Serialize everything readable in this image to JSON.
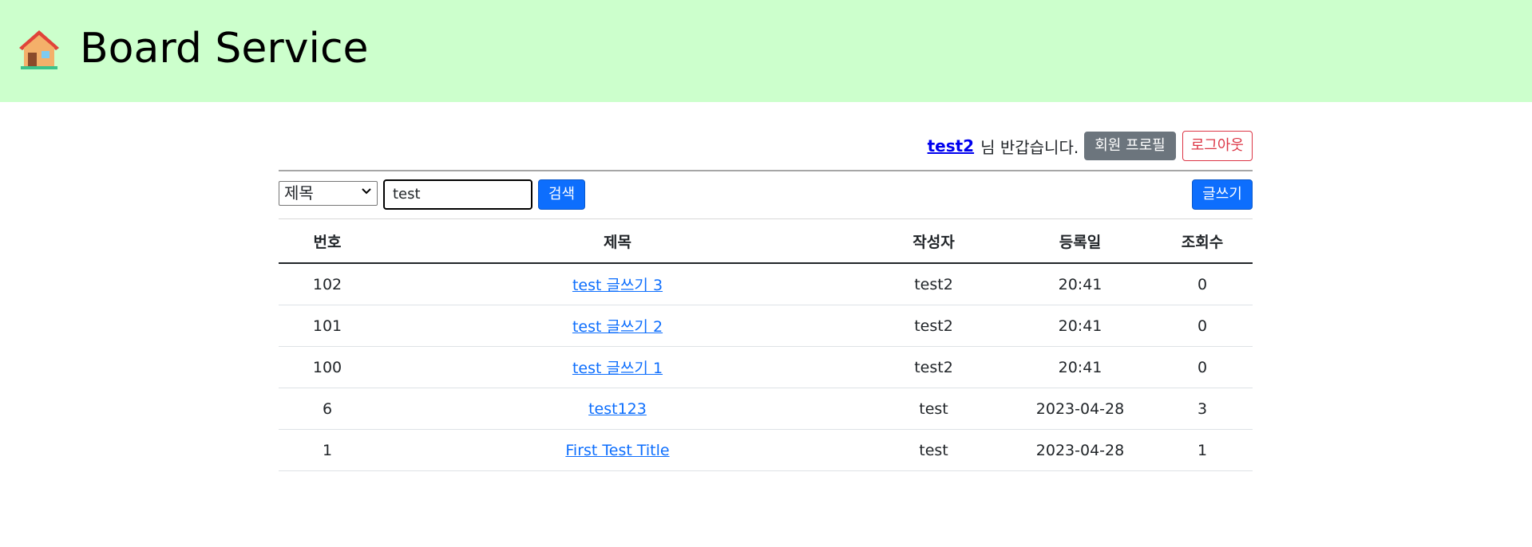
{
  "header": {
    "title": "Board Service",
    "icon": "house-icon"
  },
  "userbar": {
    "username": "test2",
    "greeting": "님 반갑습니다.",
    "profile_button": "회원 프로필",
    "logout_button": "로그아웃"
  },
  "search": {
    "select_value": "제목",
    "input_value": "test",
    "search_button": "검색",
    "write_button": "글쓰기"
  },
  "table": {
    "headers": [
      "번호",
      "제목",
      "작성자",
      "등록일",
      "조회수"
    ],
    "rows": [
      {
        "no": "102",
        "title": "test 글쓰기 3",
        "author": "test2",
        "date": "20:41",
        "views": "0"
      },
      {
        "no": "101",
        "title": "test 글쓰기 2",
        "author": "test2",
        "date": "20:41",
        "views": "0"
      },
      {
        "no": "100",
        "title": "test 글쓰기 1",
        "author": "test2",
        "date": "20:41",
        "views": "0"
      },
      {
        "no": "6",
        "title": "test123",
        "author": "test",
        "date": "2023-04-28",
        "views": "3"
      },
      {
        "no": "1",
        "title": "First Test Title",
        "author": "test",
        "date": "2023-04-28",
        "views": "1"
      }
    ]
  },
  "colors": {
    "header_bg": "#ccffcc",
    "primary": "#0d6efd",
    "secondary": "#6c757d",
    "danger": "#dc3545"
  }
}
